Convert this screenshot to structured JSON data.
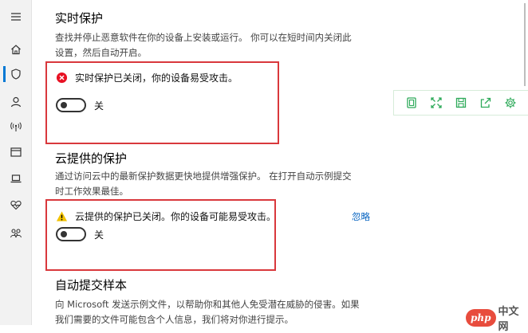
{
  "sidebar": {
    "items": [
      {
        "icon": "menu-icon"
      },
      {
        "icon": "home-icon"
      },
      {
        "icon": "shield-icon"
      },
      {
        "icon": "person-icon"
      },
      {
        "icon": "wifi-icon"
      },
      {
        "icon": "browser-window-icon"
      },
      {
        "icon": "laptop-icon"
      },
      {
        "icon": "heart-health-icon"
      },
      {
        "icon": "family-icon"
      }
    ],
    "active_index": 2
  },
  "realtime": {
    "title": "实时保护",
    "desc_line1": "查找并停止恶意软件在你的设备上安装或运行。 你可以在短时间内关闭此",
    "desc_line2": "设置，然后自动开启。",
    "alert": "实时保护已关闭，你的设备易受攻击。",
    "toggle_label": "关",
    "toggle_on": false
  },
  "cloud": {
    "title": "云提供的保护",
    "desc_line1": "通过访问云中的最新保护数据更快地提供增强保护。 在打开自动示例提交",
    "desc_line2": "时工作效果最佳。",
    "alert": "云提供的保护已关闭。你的设备可能易受攻击。",
    "ignore_link": "忽略",
    "toggle_label": "关",
    "toggle_on": false
  },
  "sample": {
    "title": "自动提交样本",
    "desc_line1": "向 Microsoft 发送示例文件，以帮助你和其他人免受潜在威胁的侵害。如果",
    "desc_line2": "我们需要的文件可能包含个人信息，我们将对你进行提示。"
  },
  "toolbar": {
    "buttons": [
      "copy-icon",
      "expand-icon",
      "save-icon",
      "share-icon",
      "settings-gear-icon"
    ]
  },
  "watermark": {
    "logo": "php",
    "text": "中文网"
  },
  "colors": {
    "highlight_border": "#d9383c",
    "error_icon": "#e81123",
    "warning_icon": "#f2c200",
    "link": "#0a66c2",
    "toolbar_accent": "#2eaa5a"
  }
}
